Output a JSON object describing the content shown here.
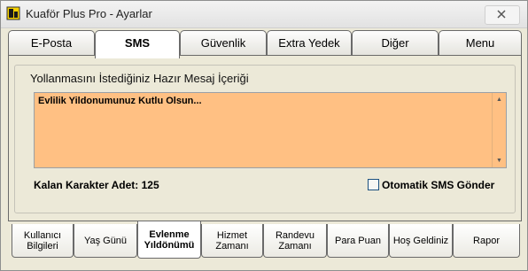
{
  "window": {
    "title": "Kuaför Plus Pro - Ayarlar",
    "app_icon": "app-logo-icon",
    "close_icon": "close-icon"
  },
  "top_tabs": [
    {
      "label": "E-Posta",
      "active": false
    },
    {
      "label": "SMS",
      "active": true
    },
    {
      "label": "Güvenlik",
      "active": false
    },
    {
      "label": "Extra Yedek",
      "active": false
    },
    {
      "label": "Diğer",
      "active": false
    },
    {
      "label": "Menu",
      "active": false
    }
  ],
  "sms_panel": {
    "group_title": "Yollanmasını İstediğiniz Hazır Mesaj İçeriği",
    "message_text": "Evlilik Yildonumunuz Kutlu Olsun...",
    "remaining_label": "Kalan Karakter Adet: 125",
    "auto_send_label": "Otomatik SMS Gönder",
    "auto_send_checked": false,
    "message_bg_color": "#ffc083"
  },
  "bottom_tabs": [
    {
      "line1": "Kullanıcı",
      "line2": "Bilgileri",
      "active": false
    },
    {
      "line1": "Yaş Günü",
      "line2": "",
      "active": false
    },
    {
      "line1": "Evlenme",
      "line2": "Yıldönümü",
      "active": true
    },
    {
      "line1": "Hizmet",
      "line2": "Zamanı",
      "active": false
    },
    {
      "line1": "Randevu",
      "line2": "Zamanı",
      "active": false
    },
    {
      "line1": "Para Puan",
      "line2": "",
      "active": false
    },
    {
      "line1": "Hoş Geldiniz",
      "line2": "",
      "active": false
    },
    {
      "line1": "Rapor",
      "line2": "",
      "active": false
    }
  ]
}
